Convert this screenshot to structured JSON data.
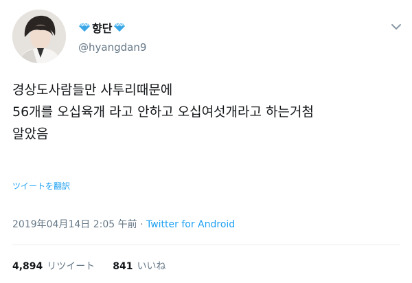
{
  "user": {
    "display_name": "향단",
    "handle": "@hyangdan9",
    "avatar_icon": "profile-photo",
    "badge_icon": "diamond-icon",
    "badge_color": "#6fc3f2"
  },
  "tweet": {
    "lines": [
      "경상도사람들만 사투리때문에",
      "56개를 오십육개 라고 안하고 오십여섯개라고 하는거첨",
      "알았음"
    ],
    "translate_label": "ツイートを翻訳",
    "timestamp": "2019年04月14日 2:05 午前",
    "separator": "·",
    "source": "Twitter for Android"
  },
  "stats": {
    "retweets_count": "4,894",
    "retweets_label": "リツイート",
    "likes_count": "841",
    "likes_label": "いいね"
  },
  "colors": {
    "link": "#1da1f2",
    "secondary_text": "#657786",
    "primary_text": "#14171a"
  }
}
